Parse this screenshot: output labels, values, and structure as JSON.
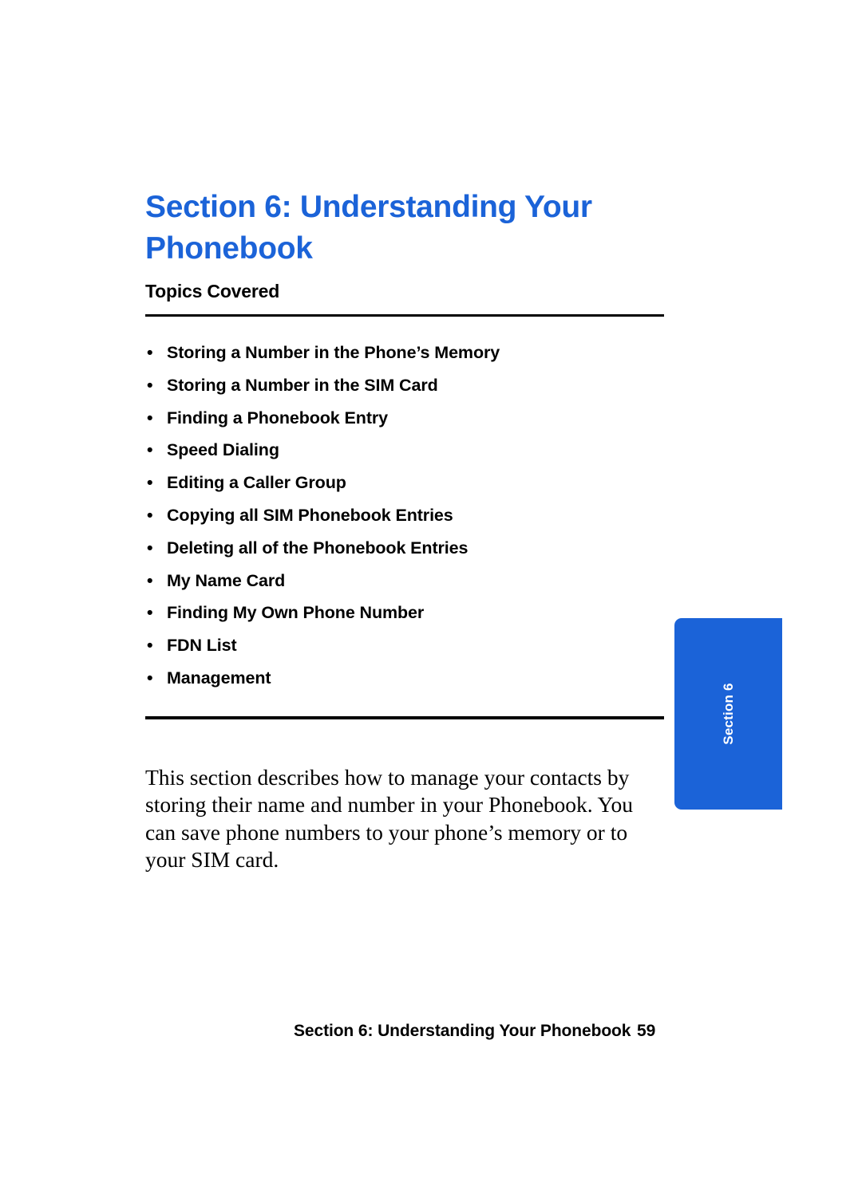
{
  "document": {
    "title_line1": "Section 6: Understanding Your",
    "title_line2": "Phonebook",
    "topics_heading": "Topics Covered",
    "bullet_glyph": "•",
    "topics": [
      "Storing a Number in the Phone’s Memory",
      "Storing a Number in the SIM Card",
      "Finding a Phonebook Entry",
      "Speed Dialing",
      "Editing a Caller Group",
      "Copying all SIM Phonebook Entries",
      "Deleting all of the Phonebook Entries",
      "My Name Card",
      "Finding My Own Phone Number",
      "FDN List",
      "Management"
    ],
    "intro_paragraph": "This section describes how to manage your contacts by storing their name and number in your Phonebook. You can save phone numbers to your phone’s memory or to your SIM card.",
    "section_tab_label": "Section 6",
    "footer_title": "Section 6: Understanding Your Phonebook",
    "footer_page": "59",
    "accent_color": "#1B63D8"
  }
}
